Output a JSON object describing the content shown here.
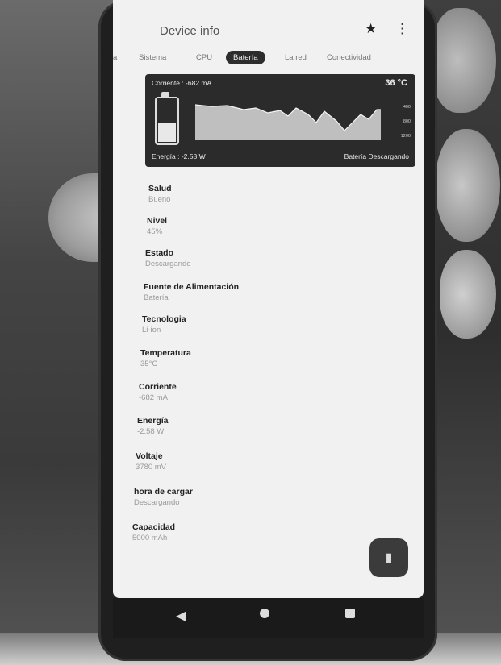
{
  "app": {
    "title": "Device info"
  },
  "appbar_icons": {
    "star": "star-icon",
    "more": "more-vert-icon"
  },
  "tabs": [
    {
      "label": "Sistema",
      "active": false
    },
    {
      "label": "CPU",
      "active": false
    },
    {
      "label": "Batería",
      "active": true
    },
    {
      "label": "La red",
      "active": false
    },
    {
      "label": "Conectividad",
      "active": false
    }
  ],
  "battery_card": {
    "current": "Corriente : -682 mA",
    "temperature": "36 °C",
    "energy": "Energía : -2.58 W",
    "status": "Batería Descargando",
    "axis_ticks": [
      "400",
      "800",
      "1200"
    ],
    "level_fraction": 0.45
  },
  "details": [
    {
      "label": "Salud",
      "value": "Bueno"
    },
    {
      "label": "Nivel",
      "value": "45%"
    },
    {
      "label": "Estado",
      "value": "Descargando"
    },
    {
      "label": "Fuente de Alimentación",
      "value": "Batería"
    },
    {
      "label": "Tecnologia",
      "value": "Li-ion"
    },
    {
      "label": "Temperatura",
      "value": "35°C"
    },
    {
      "label": "Corriente",
      "value": "-682 mA"
    },
    {
      "label": "Energía",
      "value": "-2.58 W"
    },
    {
      "label": "Voltaje",
      "value": "3780 mV"
    },
    {
      "label": "hora de cargar",
      "value": "Descargando"
    },
    {
      "label": "Capacidad",
      "value": "5000 mAh"
    }
  ],
  "fab": {
    "icon": "battery-icon"
  },
  "navbar": {
    "back": "back-icon",
    "home": "home-icon",
    "recents": "recents-icon"
  }
}
